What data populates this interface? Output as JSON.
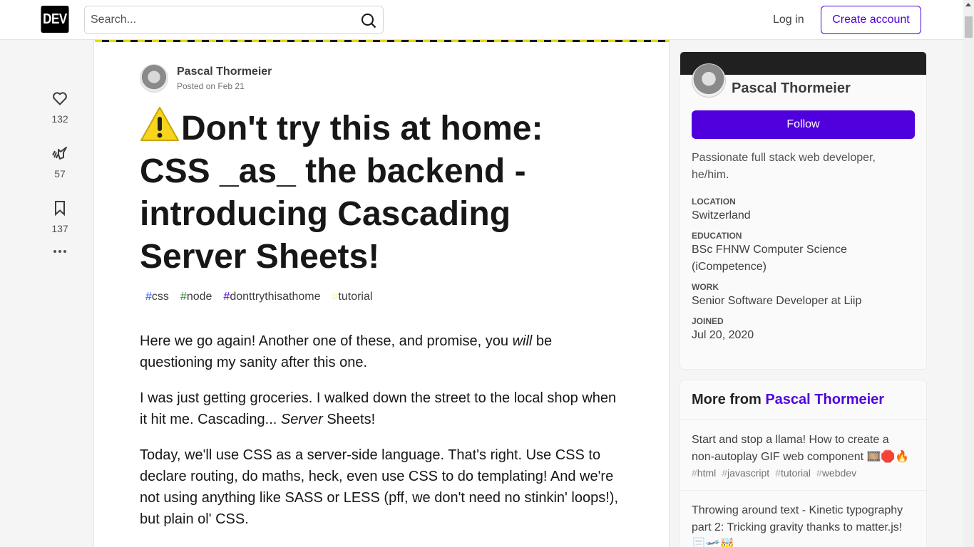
{
  "header": {
    "logo_text": "DEV",
    "search_placeholder": "Search...",
    "login_label": "Log in",
    "create_account_label": "Create account"
  },
  "reactions": [
    {
      "name": "heart",
      "icon": "heart-icon",
      "count": "132"
    },
    {
      "name": "unicorn",
      "icon": "unicorn-icon",
      "count": "57"
    },
    {
      "name": "bookmark",
      "icon": "bookmark-icon",
      "count": "137"
    }
  ],
  "article": {
    "author": "Pascal Thormeier",
    "posted": "Posted on Feb 21",
    "title_emoji": "warning-icon",
    "title": "Don't try this at home: CSS _as_ the backend - introducing Cascading Server Sheets!",
    "tags": [
      {
        "label": "css",
        "hash_color": "#2965f1"
      },
      {
        "label": "node",
        "hash_color": "#3c873a"
      },
      {
        "label": "donttrythisathome",
        "hash_color": "#4f00dd"
      },
      {
        "label": "tutorial",
        "hash_color": "#fef9a0"
      }
    ],
    "paragraphs": [
      {
        "before": "Here we go again! Another one of these, and promise, you ",
        "em": "will",
        "after": " be questioning my sanity after this one."
      },
      {
        "before": "I was just getting groceries. I walked down the street to the local shop when it hit me. Cascading... ",
        "em": "Server",
        "after": " Sheets!"
      },
      {
        "before": "Today, we'll use CSS as a server-side language. That's right. Use CSS to declare routing, do maths, heck, even use CSS to do templating! And we're not using anything like SASS or LESS (pff, we don't need no stinkin' loops!), but plain ol' CSS.",
        "em": "",
        "after": ""
      }
    ]
  },
  "profile": {
    "name": "Pascal Thormeier",
    "follow_label": "Follow",
    "bio": "Passionate full stack web developer, he/him.",
    "fields": [
      {
        "key": "Location",
        "value": "Switzerland"
      },
      {
        "key": "Education",
        "value": "BSc FHNW Computer Science (iCompetence)"
      },
      {
        "key": "Work",
        "value": "Senior Software Developer at Liip"
      },
      {
        "key": "Joined",
        "value": "Jul 20, 2020"
      }
    ]
  },
  "more_from": {
    "prefix": "More from ",
    "author": "Pascal Thormeier",
    "items": [
      {
        "title": "Start and stop a llama! How to create a non-autoplay GIF web component 🎞️🛑🔥",
        "tags": [
          "html",
          "javascript",
          "tutorial",
          "webdev"
        ]
      },
      {
        "title": "Throwing around text - Kinetic typography part 2: Tricking gravity thanks to matter.js! 📃🛫🤯",
        "tags": []
      }
    ]
  },
  "colors": {
    "brand": "#4f00dd",
    "hazard_yellow": "#e8d800"
  }
}
